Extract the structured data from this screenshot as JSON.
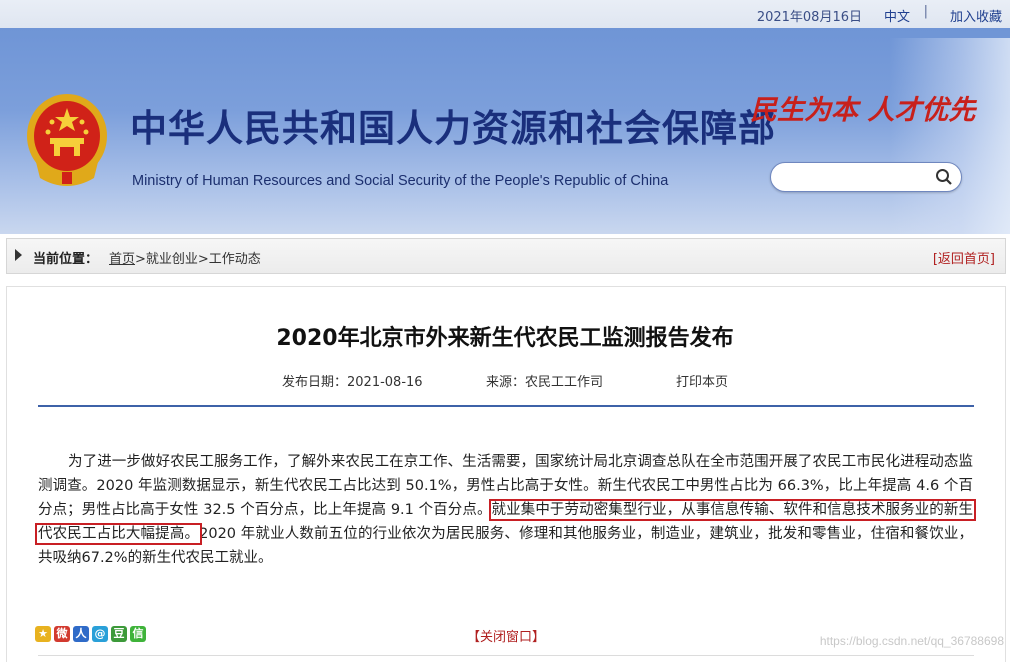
{
  "topbar": {
    "date": "2021年08月16日",
    "lang_link": "中文",
    "separator": "|",
    "favorite_link": "加入收藏"
  },
  "banner": {
    "title_cn": "中华人民共和国人力资源和社会保障部",
    "title_en": "Ministry of Human Resources and Social Security of the People's Republic of China",
    "slogan": "民生为本 人才优先",
    "search_placeholder": "",
    "search_icon": "search-icon",
    "emblem_icon": "national-emblem-icon"
  },
  "breadcrumb": {
    "label": "当前位置：",
    "home": "首页",
    "rest": ">就业创业>工作动态",
    "back": "[返回首页]"
  },
  "article": {
    "title": "2020年北京市外来新生代农民工监测报告发布",
    "publish_date": "发布日期：2021-08-16",
    "source": "来源：农民工工作司",
    "print": "打印本页",
    "para_part1": "为了进一步做好农民工服务工作，了解外来农民工在京工作、生活需要，国家统计局北京调查总队在全市范围开展了农民工市民化进程动态监测调查。2020 年监测数据显示，新生代农民工占比达到 50.1%，男性占比高于女性。新生代农民工中男性占比为 66.3%，比上年提高 4.6 个百分点；男性占比高于女性 32.5 个百分点，比上年提高 9.1 个百分点。",
    "para_highlight": "就业集中于劳动密集型行业，从事信息传输、软件和信息技术服务业的新生代农民工占比大幅提高。",
    "para_part2": "2020 年就业人数前五位的行业依次为居民服务、修理和其他服务业，制造业，建筑业，批发和零售业，住宿和餐饮业，共吸纳67.2%的新生代农民工就业。"
  },
  "footer": {
    "share_icons": [
      "qzone-icon",
      "weibo-icon",
      "renren-icon",
      "pengyou-icon",
      "douban-icon",
      "wechat-icon"
    ],
    "share_glyphs": [
      "★",
      "微",
      "人",
      "@",
      "豆",
      "信"
    ],
    "close": "【关闭窗口】",
    "watermark": "https://blog.csdn.net/qq_36788698"
  },
  "colors": {
    "brand_blue": "#1a2f7c",
    "slogan_red": "#c8201b",
    "highlight_red": "#c81f24",
    "rule_blue": "#3e62a8"
  }
}
